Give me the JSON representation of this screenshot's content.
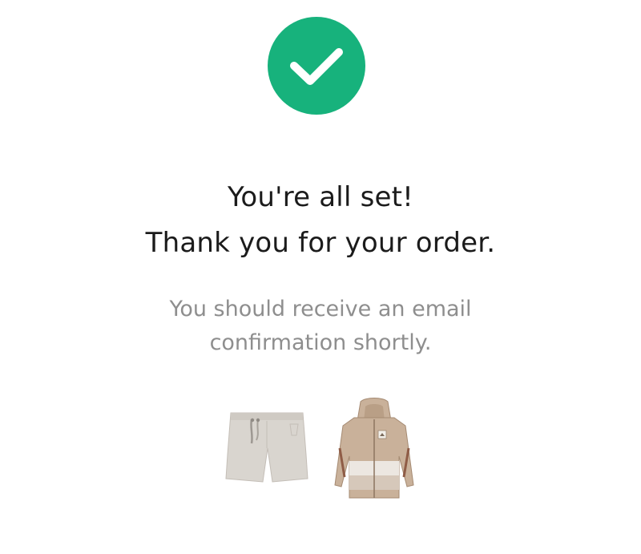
{
  "confirmation": {
    "icon": "checkmark-icon",
    "accent_color": "#17b27c",
    "title_line1": "You're all set!",
    "title_line2": "Thank you for your order.",
    "message_line1": "You should receive an email",
    "message_line2": "confirmation shortly."
  },
  "order_items": [
    {
      "icon": "shorts-product-image"
    },
    {
      "icon": "jacket-product-image"
    }
  ]
}
